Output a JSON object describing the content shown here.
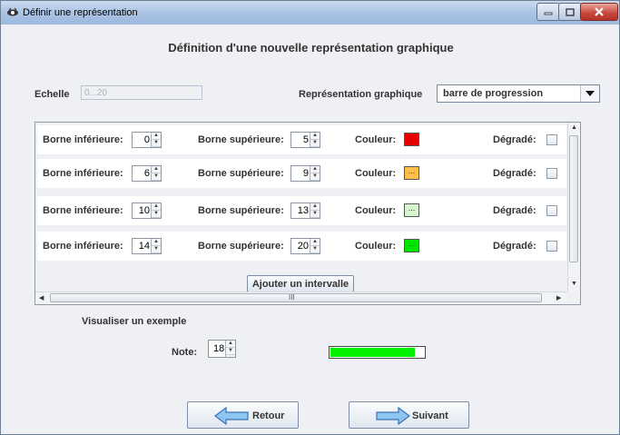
{
  "window": {
    "title": "Définir une représentation"
  },
  "heading": "Définition d'une nouvelle représentation graphique",
  "scale": {
    "label": "Echelle",
    "value": "0...20"
  },
  "representation": {
    "label": "Représentation graphique",
    "selected": "barre de progression"
  },
  "intervals": [
    {
      "lower_label": "Borne inférieure:",
      "lower": "0",
      "upper_label": "Borne supérieure:",
      "upper": "5",
      "color_label": "Couleur:",
      "color": "#e60000",
      "color_text": "",
      "gradient_label": "Dégradé:"
    },
    {
      "lower_label": "Borne inférieure:",
      "lower": "6",
      "upper_label": "Borne supérieure:",
      "upper": "9",
      "color_label": "Couleur:",
      "color": "#ffc04a",
      "color_text": "...",
      "gradient_label": "Dégradé:"
    },
    {
      "lower_label": "Borne inférieure:",
      "lower": "10",
      "upper_label": "Borne supérieure:",
      "upper": "13",
      "color_label": "Couleur:",
      "color": "#d7f5d0",
      "color_text": "...",
      "gradient_label": "Dégradé:"
    },
    {
      "lower_label": "Borne inférieure:",
      "lower": "14",
      "upper_label": "Borne supérieure:",
      "upper": "20",
      "color_label": "Couleur:",
      "color": "#00e600",
      "color_text": "...",
      "gradient_label": "Dégradé:"
    }
  ],
  "add_interval_label": "Ajouter un intervalle",
  "hscroll_grip": "III",
  "example": {
    "title": "Visualiser un exemple",
    "note_label": "Note:",
    "note_value": "18",
    "progress_fraction": 0.9,
    "progress_color": "#00f000"
  },
  "buttons": {
    "back": "Retour",
    "next": "Suivant"
  }
}
